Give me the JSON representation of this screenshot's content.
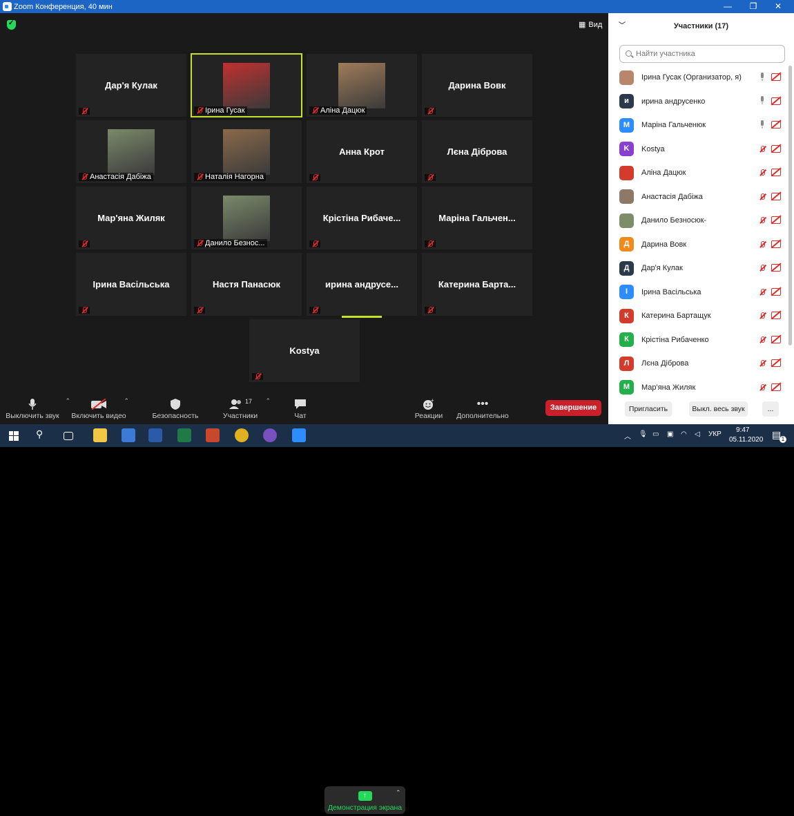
{
  "window": {
    "title": "Zoom Конференция, 40 мин",
    "minimize": "—",
    "maximize": "❐",
    "close": "✕"
  },
  "view_label": "Вид",
  "tiles": [
    {
      "name": "Дар'я Кулак",
      "caption": "",
      "photo": false
    },
    {
      "name": "",
      "caption": "Ірина Гусак",
      "photo": true,
      "selected": true
    },
    {
      "name": "",
      "caption": "Аліна Дацюк",
      "photo": true
    },
    {
      "name": "Дарина Вовк",
      "caption": "",
      "photo": false
    },
    {
      "name": "",
      "caption": "Анастасія Дабіжа",
      "photo": true
    },
    {
      "name": "",
      "caption": "Наталія Нагорна",
      "photo": true
    },
    {
      "name": "Анна Крот",
      "caption": "",
      "photo": false
    },
    {
      "name": "Лєна Діброва",
      "caption": "",
      "photo": false
    },
    {
      "name": "Мар'яна Жиляк",
      "caption": "",
      "photo": false
    },
    {
      "name": "",
      "caption": "Данило Безнос...",
      "photo": true
    },
    {
      "name": "Крістіна Рибаче...",
      "caption": "",
      "photo": false
    },
    {
      "name": "Маріна Гальчен...",
      "caption": "",
      "photo": false
    },
    {
      "name": "Ірина Васільська",
      "caption": "",
      "photo": false
    },
    {
      "name": "Настя Панасюк",
      "caption": "",
      "photo": false
    },
    {
      "name": "ирина андрусе...",
      "caption": "",
      "photo": false
    },
    {
      "name": "Катерина Барта...",
      "caption": "",
      "photo": false
    },
    {
      "name": "Kostya",
      "caption": "",
      "photo": false
    }
  ],
  "toolbar": {
    "mute": "Выключить звук",
    "video": "Включить видео",
    "security": "Безопасность",
    "participants": "Участники",
    "participants_count": "17",
    "chat": "Чат",
    "share": "Демонстрация экрана",
    "reactions": "Реакции",
    "more": "Дополнительно",
    "end": "Завершение"
  },
  "panel": {
    "title": "Участники (17)",
    "search_placeholder": "Найти участника",
    "invite": "Пригласить",
    "mute_all": "Выкл. весь звук",
    "more": "...",
    "participants": [
      {
        "name": "Ірина Гусак (Организатор, я)",
        "initial": "",
        "color": "#b8866a",
        "mic": "on"
      },
      {
        "name": "ирина андрусенко",
        "initial": "и",
        "color": "#2b3a4a",
        "mic": "on"
      },
      {
        "name": "Маріна Гальченюк",
        "initial": "М",
        "color": "#2d8cff",
        "mic": "on"
      },
      {
        "name": "Kostya",
        "initial": "K",
        "color": "#8a3fd1",
        "mic": "off"
      },
      {
        "name": "Аліна Дацюк",
        "initial": "",
        "color": "#d33b2c",
        "mic": "off"
      },
      {
        "name": "Анастасія Дабіжа",
        "initial": "",
        "color": "#8d7a66",
        "mic": "off"
      },
      {
        "name": "Данило Безнoсюк-",
        "initial": "",
        "color": "#7d8d6a",
        "mic": "off"
      },
      {
        "name": "Дарина Вовк",
        "initial": "Д",
        "color": "#f08a1c",
        "mic": "off"
      },
      {
        "name": "Дар'я Кулак",
        "initial": "Д",
        "color": "#2b3a4a",
        "mic": "off"
      },
      {
        "name": "Ірина Васільська",
        "initial": "І",
        "color": "#2d8cff",
        "mic": "off"
      },
      {
        "name": "Катерина Бартащук",
        "initial": "К",
        "color": "#d33b2c",
        "mic": "off"
      },
      {
        "name": "Крістіна Рибаченко",
        "initial": "К",
        "color": "#23b04a",
        "mic": "off"
      },
      {
        "name": "Лєна Діброва",
        "initial": "Л",
        "color": "#d33b2c",
        "mic": "off"
      },
      {
        "name": "Мар'яна Жиляк",
        "initial": "М",
        "color": "#23b04a",
        "mic": "off"
      }
    ]
  },
  "taskbar": {
    "lang": "УКР",
    "time": "9:47",
    "date": "05.11.2020",
    "notif": "1"
  }
}
